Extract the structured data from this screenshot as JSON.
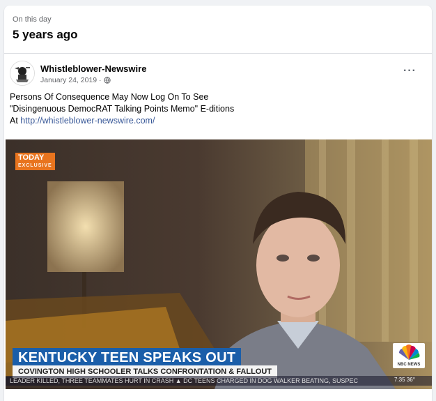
{
  "memory": {
    "eyebrow": "On this day",
    "years": "5 years ago"
  },
  "post": {
    "page_name": "Whistleblower-Newswire",
    "date": "January 24, 2019 ·",
    "audience_icon": "globe-icon",
    "more_label": "···",
    "text_line1": "Persons Of Consequence May Now Log On To See",
    "text_line2": "\"Disingenuous DemocRAT Talking Points Memo\" E-ditions",
    "text_line3_prefix": "At ",
    "link": "http://whistleblower-newswire.com/"
  },
  "video": {
    "today_tag": "TODAY",
    "today_sub": "EXCLUSIVE",
    "headline": "KENTUCKY TEEN SPEAKS OUT",
    "subheadline": "COVINGTON HIGH SCHOOLER TALKS CONFRONTATION & FALLOUT",
    "ticker": "LEADER KILLED, THREE TEAMMATES HURT IN CRASH   ▲   DC TEENS CHARGED IN DOG WALKER BEATING, SUSPEC",
    "network": "NBC NEWS",
    "clock": "7:35  36°"
  },
  "colors": {
    "link": "#385898",
    "chyron_blue": "#1a5ea9",
    "today_orange": "#e8741e"
  }
}
